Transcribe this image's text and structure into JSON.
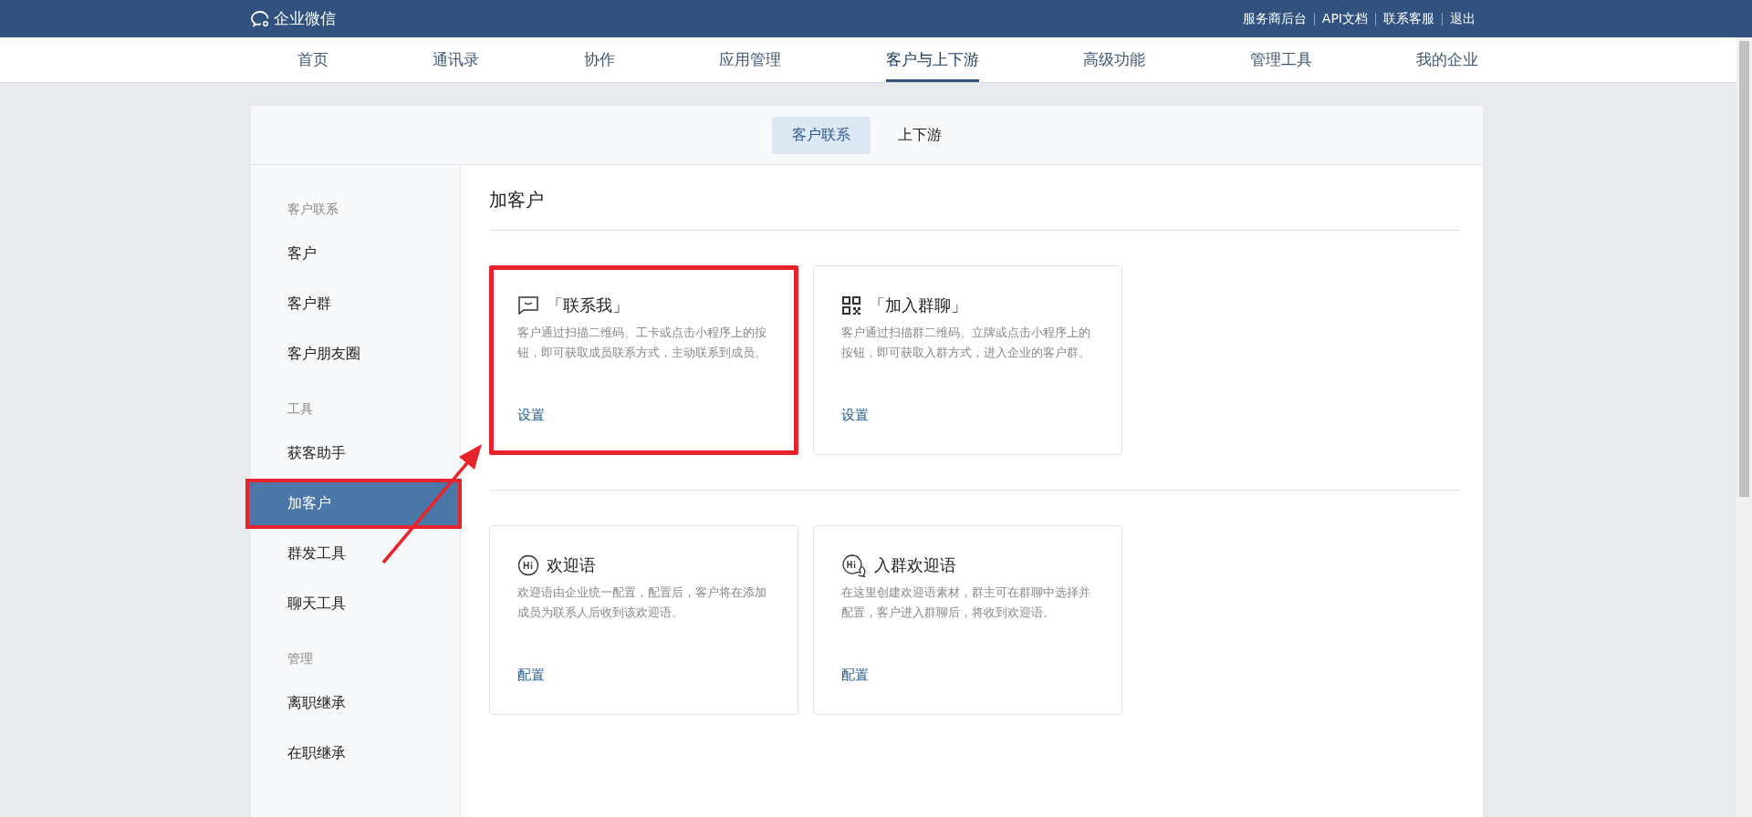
{
  "header": {
    "logo_text": "企业微信",
    "links": [
      "服务商后台",
      "API文档",
      "联系客服",
      "退出"
    ]
  },
  "nav": [
    {
      "label": "首页",
      "selected": false
    },
    {
      "label": "通讯录",
      "selected": false
    },
    {
      "label": "协作",
      "selected": false
    },
    {
      "label": "应用管理",
      "selected": false
    },
    {
      "label": "客户与上下游",
      "selected": true
    },
    {
      "label": "高级功能",
      "selected": false
    },
    {
      "label": "管理工具",
      "selected": false
    },
    {
      "label": "我的企业",
      "selected": false
    }
  ],
  "subtabs": [
    {
      "label": "客户联系",
      "selected": true
    },
    {
      "label": "上下游",
      "selected": false
    }
  ],
  "sidebar": [
    {
      "title": "客户联系",
      "items": [
        {
          "label": "客户",
          "selected": false,
          "highlighted": false
        },
        {
          "label": "客户群",
          "selected": false,
          "highlighted": false
        },
        {
          "label": "客户朋友圈",
          "selected": false,
          "highlighted": false
        }
      ]
    },
    {
      "title": "工具",
      "items": [
        {
          "label": "获客助手",
          "selected": false,
          "highlighted": false
        },
        {
          "label": "加客户",
          "selected": true,
          "highlighted": true
        },
        {
          "label": "群发工具",
          "selected": false,
          "highlighted": false
        },
        {
          "label": "聊天工具",
          "selected": false,
          "highlighted": false
        }
      ]
    },
    {
      "title": "管理",
      "items": [
        {
          "label": "离职继承",
          "selected": false,
          "highlighted": false
        },
        {
          "label": "在职继承",
          "selected": false,
          "highlighted": false
        }
      ]
    }
  ],
  "content": {
    "title": "加客户",
    "card_rows": [
      [
        {
          "kind": "chat",
          "title": "「联系我」",
          "description": "客户通过扫描二维码、工卡或点击小程序上的按钮，即可获取成员联系方式，主动联系到成员。",
          "link": "设置",
          "highlighted": true
        },
        {
          "kind": "qr",
          "title": "「加入群聊」",
          "description": "客户通过扫描群二维码、立牌或点击小程序上的按钮，即可获取入群方式，进入企业的客户群。",
          "link": "设置",
          "highlighted": false
        }
      ],
      [
        {
          "kind": "hi",
          "title": "欢迎语",
          "description": "欢迎语由企业统一配置，配置后，客户将在添加成员为联系人后收到该欢迎语。",
          "link": "配置",
          "highlighted": false
        },
        {
          "kind": "hi-group",
          "title": "入群欢迎语",
          "description": "在这里创建欢迎语素材，群主可在群聊中选择并配置，客户进入群聊后，将收到欢迎语。",
          "link": "配置",
          "highlighted": false
        }
      ]
    ]
  }
}
